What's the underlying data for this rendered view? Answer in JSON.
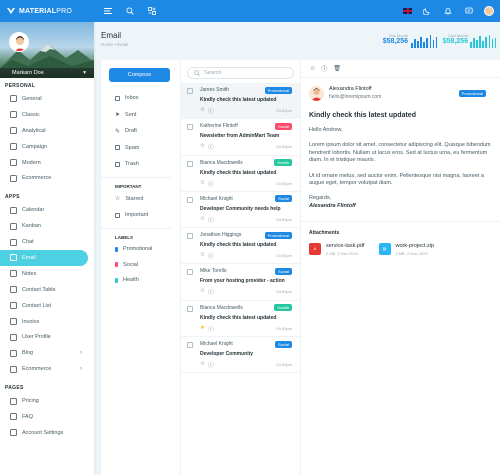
{
  "brand": {
    "name_bold": "MATERIAL",
    "name_light": "PRO"
  },
  "user": {
    "name": "Markarn Doe"
  },
  "nav": {
    "personal_title": "PERSONAL",
    "personal": [
      {
        "label": "General"
      },
      {
        "label": "Classic"
      },
      {
        "label": "Analytical"
      },
      {
        "label": "Campaign"
      },
      {
        "label": "Modern"
      },
      {
        "label": "Ecommerce"
      }
    ],
    "apps_title": "APPS",
    "apps": [
      {
        "label": "Calendar"
      },
      {
        "label": "Kanban"
      },
      {
        "label": "Chat"
      },
      {
        "label": "Email"
      },
      {
        "label": "Notes"
      },
      {
        "label": "Contact Table"
      },
      {
        "label": "Contact List"
      },
      {
        "label": "Invoice"
      },
      {
        "label": "User Profile"
      },
      {
        "label": "Blog"
      },
      {
        "label": "Ecommerce"
      }
    ],
    "pages_title": "PAGES",
    "pages": [
      {
        "label": "Pricing"
      },
      {
        "label": "FAQ"
      },
      {
        "label": "Account Settings"
      }
    ]
  },
  "header": {
    "title": "Email",
    "breadcrumb_home": "Home",
    "breadcrumb_sep": "•",
    "breadcrumb_current": "Email",
    "this_month_label": "This Month",
    "this_month_value": "$58,256",
    "last_month_label": "Last Month",
    "last_month_value": "$58,256",
    "this_color": "#1e88e5",
    "last_color": "#26c6da"
  },
  "folders": {
    "compose": "Compose",
    "items": [
      {
        "label": "Inbox"
      },
      {
        "label": "Sent"
      },
      {
        "label": "Draft"
      },
      {
        "label": "Spam"
      },
      {
        "label": "Trash"
      }
    ],
    "important_title": "IMPORTANT",
    "important": [
      {
        "label": "Starred"
      },
      {
        "label": "Important"
      }
    ],
    "labels_title": "LABELS",
    "labels": [
      {
        "label": "Promotional",
        "color": "#1e88e5"
      },
      {
        "label": "Social",
        "color": "#fc4b6c"
      },
      {
        "label": "Health",
        "color": "#26c6da"
      }
    ]
  },
  "search": {
    "placeholder": "Search"
  },
  "mails": [
    {
      "from": "James Smith",
      "badge": "Promotional",
      "badge_color": "#1e88e5",
      "subject": "Kindly check this latest updated",
      "time": "04:00pm",
      "starred": false
    },
    {
      "from": "Katherine Flintoff",
      "badge": "Social",
      "badge_color": "#fc4b6c",
      "subject": "Newsletter from AdminMart Team",
      "time": "04:00pm",
      "starred": false
    },
    {
      "from": "Bianca Macdowells",
      "badge": "Health",
      "badge_color": "#26c6a0",
      "subject": "Kindly check this latest updated",
      "time": "04:00pm",
      "starred": false
    },
    {
      "from": "Michael Knight",
      "badge": "Social",
      "badge_color": "#1e88e5",
      "subject": "Developer Community needs help",
      "time": "04:00pm",
      "starred": false
    },
    {
      "from": "Jonathan Higgings",
      "badge": "Promotional",
      "badge_color": "#1e88e5",
      "subject": "Kindly check this latest updated",
      "time": "04:00pm",
      "starred": false
    },
    {
      "from": "Mike Torello",
      "badge": "Social",
      "badge_color": "#1e88e5",
      "subject": "From your hosting provider - action",
      "time": "04:00pm",
      "starred": false
    },
    {
      "from": "Bianca Macdowells",
      "badge": "Health",
      "badge_color": "#26c6a0",
      "subject": "Kindly check this latest updated",
      "time": "04:00pm",
      "starred": true
    },
    {
      "from": "Michael Knight",
      "badge": "Social",
      "badge_color": "#1e88e5",
      "subject": "Developer Community",
      "time": "04:00pm",
      "starred": false
    }
  ],
  "reader": {
    "name": "Alexandra Flintoff",
    "email": "hello@loremipsum.com",
    "badge": "Promotional",
    "subject": "Kindly check this latest updated",
    "greeting": "Hello Andrew,",
    "para1": "Lorem ipsum dolor sit amet, consectetur adipiscing elit. Quisque bibendum hendrerit lobortis. Nullam ut lacus eros. Sed at luctus urna, eu fermentum diam. In et tristique mauris.",
    "para2": "Ut id ornare metus, sed auctor enim. Pellentesque nisi magna, laoreet a augue eget, tempor volutpat diam.",
    "regards": "Regards,",
    "signature": "Alexandra Flintoff",
    "attachments_title": "Attachments",
    "attachments": [
      {
        "name": "service-task.pdf",
        "size": "2 MB",
        "date": "2 Dec 2023",
        "icon": "pdf-icon",
        "color": "#e53935",
        "glyph": "A"
      },
      {
        "name": "work-project.zip",
        "size": "2 MB",
        "date": "2 Dec 2023",
        "icon": "zip-icon",
        "color": "#29b6f6",
        "glyph": "⬚"
      }
    ]
  }
}
